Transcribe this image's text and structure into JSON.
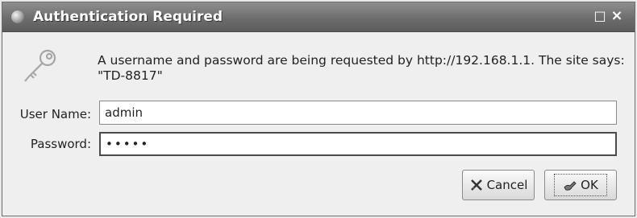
{
  "window": {
    "title": "Authentication Required",
    "maximize_glyph": "□",
    "close_glyph": "×"
  },
  "dialog": {
    "icon": "key-icon",
    "message": "A username and password are being requested by http://192.168.1.1. The site says:\n\"TD-8817\""
  },
  "form": {
    "username_label": "User Name:",
    "username_value": "admin",
    "password_label": "Password:",
    "password_value": "•••••"
  },
  "buttons": {
    "cancel_label": "Cancel",
    "ok_label": "OK"
  }
}
